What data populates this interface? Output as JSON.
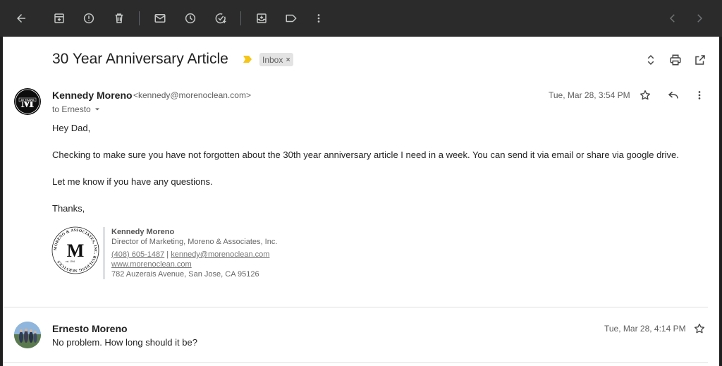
{
  "toolbar": {
    "buttons": [
      "back-arrow-icon",
      "archive-icon",
      "report-spam-icon",
      "delete-icon",
      "mark-unread-icon",
      "snooze-icon",
      "add-task-icon",
      "move-to-icon",
      "label-icon",
      "more-vert-icon"
    ],
    "nav": [
      "chevron-left-icon",
      "chevron-right-icon"
    ]
  },
  "thread": {
    "subject": "30 Year Anniversary Article",
    "label_chip": "Inbox",
    "label_close": "×"
  },
  "message1": {
    "sender_name": "Kennedy Moreno",
    "sender_email": "<kennedy@morenoclean.com>",
    "to": "to Ernesto",
    "date": "Tue, Mar 28, 3:54 PM",
    "avatar_text": "M",
    "avatar_caption": "30 YEARS",
    "body": [
      "Hey Dad,",
      "Checking to make sure you have not forgotten about the 30th year anniversary article I need in a week. You can send it via email or share via google drive.",
      "Let me know if you have any questions.",
      "Thanks,"
    ],
    "signature": {
      "logo_letter": "M",
      "logo_ring_text": "MORENO & ASSOCIATES, INC. BUILDING SERVICES",
      "logo_est": "est. 1994",
      "name": "Kennedy Moreno",
      "title": "Director of Marketing, Moreno & Associates, Inc.",
      "phone": "(408) 605-1487",
      "phone_sep": " | ",
      "email": "kennedy@morenoclean.com",
      "website": "www.morenoclean.com",
      "address": "782 Auzerais Avenue, San Jose, CA 95126"
    }
  },
  "message2": {
    "sender_name": "Ernesto Moreno",
    "date": "Tue, Mar 28, 4:14 PM",
    "snippet": "No problem. How long should it be?"
  },
  "colors": {
    "toolbar_bg": "#2b2b2b",
    "page_bg": "#ffffff",
    "importance_marker": "#f5c518"
  }
}
